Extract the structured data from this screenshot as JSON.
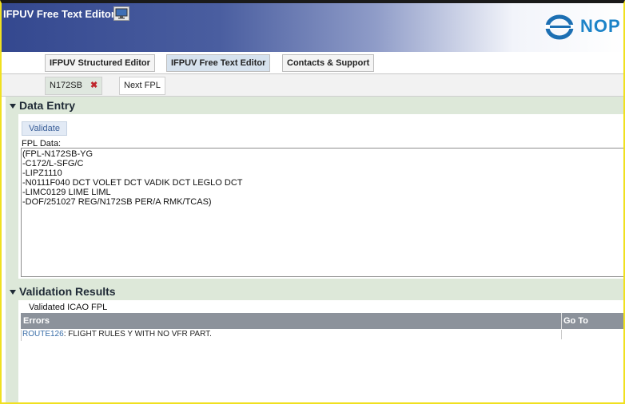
{
  "header": {
    "app_title": "IFPUV Free Text Editor",
    "logo_text": "NOP"
  },
  "tabs": [
    {
      "label": "IFPUV Structured Editor",
      "active": false
    },
    {
      "label": "IFPUV Free Text Editor",
      "active": true
    },
    {
      "label": "Contacts & Support",
      "active": false
    }
  ],
  "subtabs": {
    "flight_tab": "N172SB",
    "next_tab": "Next FPL"
  },
  "data_entry": {
    "title": "Data Entry",
    "validate_label": "Validate",
    "fpl_label": "FPL Data:",
    "fpl_text": "(FPL-N172SB-YG\n-C172/L-SFG/C\n-LIPZ1110\n-N0111F040 DCT VOLET DCT VADIK DCT LEGLO DCT\n-LIMC0129 LIME LIML\n-DOF/251027 REG/N172SB PER/A RMK/TCAS)"
  },
  "validation": {
    "title": "Validation Results",
    "validated_label": "Validated ICAO FPL",
    "columns": {
      "errors": "Errors",
      "goto": "Go To"
    },
    "errors": [
      {
        "code": "ROUTE126",
        "message": ": FLIGHT RULES Y WITH NO VFR PART."
      }
    ]
  },
  "colors": {
    "banner_start": "#34488f",
    "section_bg": "#dde8d9",
    "accent_link": "#3a6ea8",
    "close_red": "#c0272d"
  }
}
